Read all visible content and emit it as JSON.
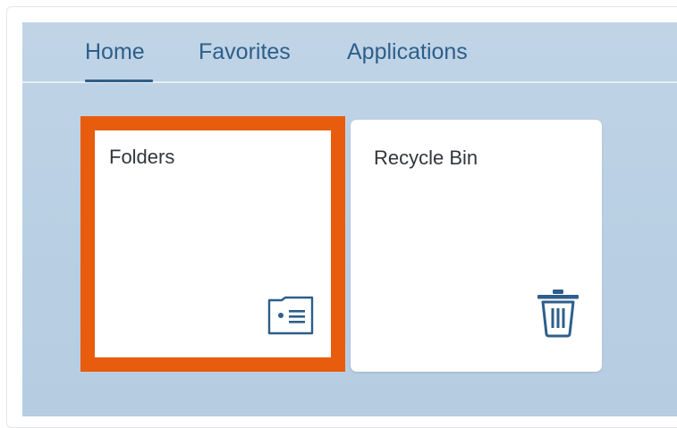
{
  "tabs": [
    {
      "label": "Home",
      "selected": true
    },
    {
      "label": "Favorites",
      "selected": false
    },
    {
      "label": "Applications",
      "selected": false
    }
  ],
  "tiles": [
    {
      "title": "Folders",
      "icon": "folder-card-icon",
      "highlighted": true
    },
    {
      "title": "Recycle Bin",
      "icon": "trash-icon",
      "highlighted": false
    }
  ],
  "colors": {
    "accent": "#2d5f8a",
    "highlight": "#e85c0d",
    "shell_background": "#bdd2e5",
    "tile_background": "#ffffff",
    "tile_text": "#32363a"
  }
}
